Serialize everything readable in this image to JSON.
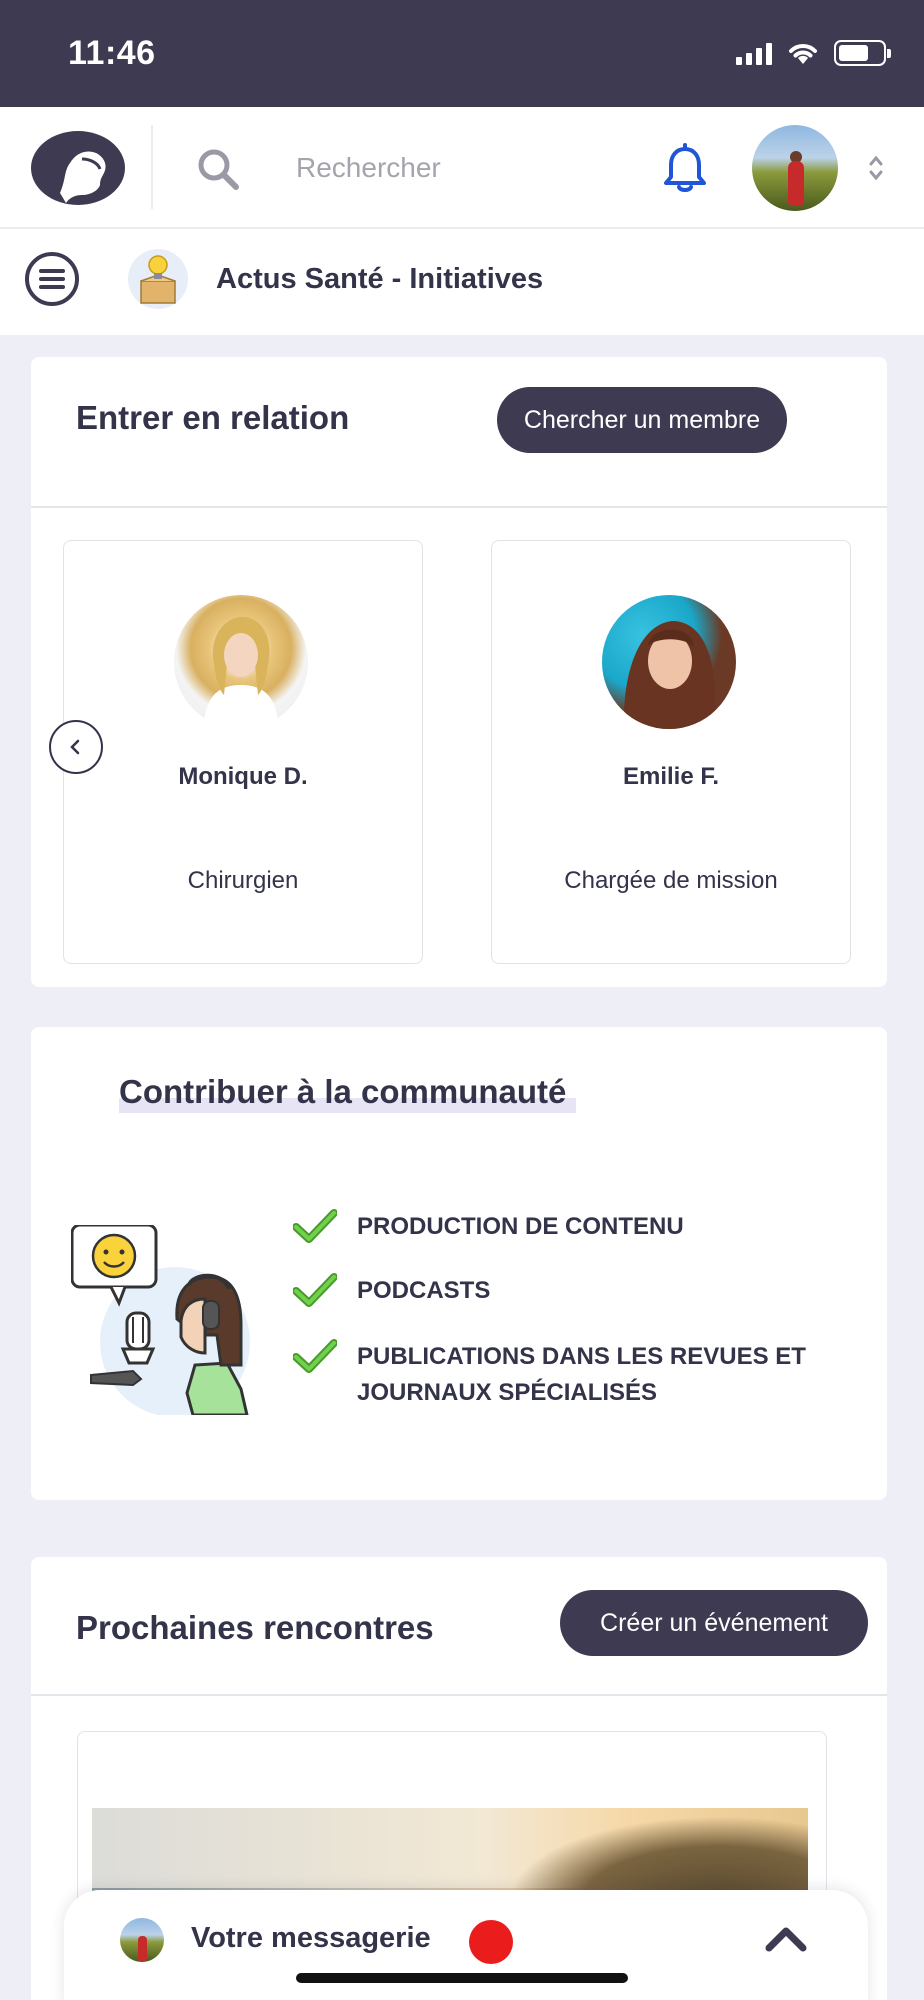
{
  "status_bar": {
    "time": "11:46"
  },
  "header": {
    "search_placeholder": "Rechercher"
  },
  "sub_header": {
    "title": "Actus Santé - Initiatives"
  },
  "connect": {
    "title": "Entrer en relation",
    "button_label": "Chercher un membre",
    "members": [
      {
        "name": "Monique D.",
        "role": "Chirurgien"
      },
      {
        "name": "Emilie F.",
        "role": "Chargée de mission"
      }
    ]
  },
  "contribute": {
    "title": "Contribuer à la communauté",
    "items": [
      "PRODUCTION DE CONTENU",
      "PODCASTS",
      "PUBLICATIONS DANS LES REVUES ET JOURNAUX SPÉCIALISÉS"
    ]
  },
  "events": {
    "title": "Prochaines rencontres",
    "button_label": "Créer un événement"
  },
  "messaging": {
    "label": "Votre messagerie"
  },
  "colors": {
    "primary_dark": "#3e3a52",
    "background": "#eeeef6",
    "bell_blue": "#1f55d6",
    "check_green": "#5cbf3c",
    "notification_red": "#ea1c1c"
  }
}
